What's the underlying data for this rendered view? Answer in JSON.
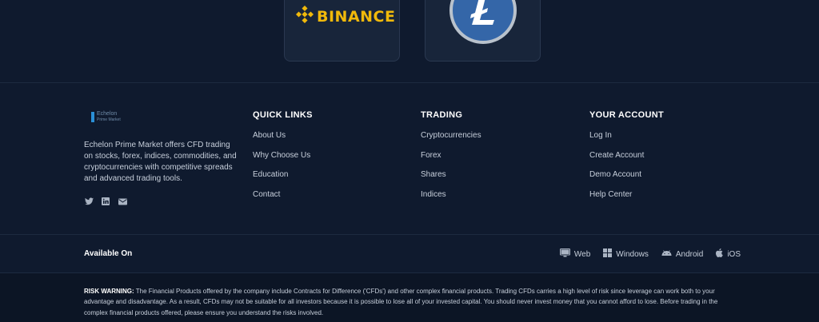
{
  "partners": {
    "binance": {
      "name": "BINANCE",
      "icon": "binance-diamond-icon",
      "color": "#f0b90b"
    },
    "litecoin": {
      "icon": "litecoin-icon",
      "color": "#3466a8"
    }
  },
  "brand": {
    "logo_text": "Echelon",
    "logo_subtext": "Prime Market",
    "description": "Echelon Prime Market offers CFD trading on stocks, forex, indices, commodities, and cryptocurrencies with competitive spreads and advanced trading tools.",
    "socials": [
      "twitter-icon",
      "linkedin-icon",
      "mail-icon"
    ]
  },
  "columns": {
    "quick": {
      "title": "QUICK LINKS",
      "links": [
        "About Us",
        "Why Choose Us",
        "Education",
        "Contact"
      ]
    },
    "trading": {
      "title": "TRADING",
      "links": [
        "Cryptocurrencies",
        "Forex",
        "Shares",
        "Indices"
      ]
    },
    "account": {
      "title": "YOUR ACCOUNT",
      "links": [
        "Log In",
        "Create Account",
        "Demo Account",
        "Help Center"
      ]
    }
  },
  "available": {
    "label": "Available On",
    "platforms": [
      {
        "label": "Web",
        "icon": "monitor-icon"
      },
      {
        "label": "Windows",
        "icon": "windows-icon"
      },
      {
        "label": "Android",
        "icon": "android-icon"
      },
      {
        "label": "iOS",
        "icon": "apple-icon"
      }
    ]
  },
  "risk": {
    "title": "RISK WARNING:",
    "text": "The Financial Products offered by the company include Contracts for Difference ('CFDs') and other complex financial products. Trading CFDs carries a high level of risk since leverage can work both to your advantage and disadvantage. As a result, CFDs may not be suitable for all investors because it is possible to lose all of your invested capital. You should never invest money that you cannot afford to lose. Before trading in the complex financial products offered, please ensure you understand the risks involved."
  },
  "colors": {
    "background": "#0f1a2e",
    "risk_background": "#0c1525",
    "heading": "#ffffff",
    "text": "#c7cfdb"
  }
}
